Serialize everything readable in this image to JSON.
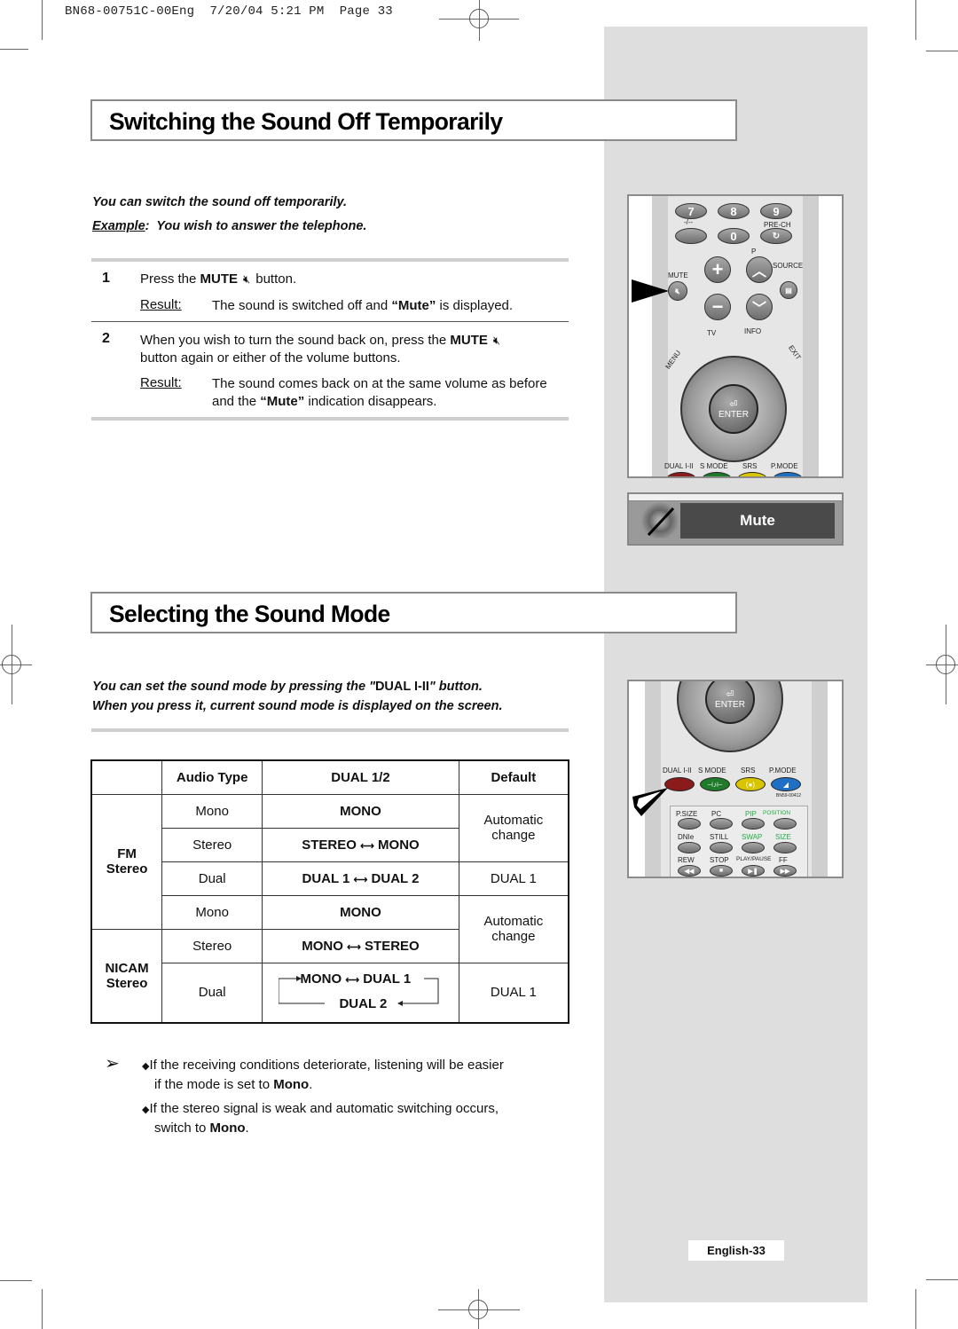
{
  "print_header": {
    "doc_id": "BN68-00751C-00Eng",
    "date": "7/20/04",
    "time": "5:21 PM",
    "page": "Page 33"
  },
  "section1": {
    "title": "Switching the Sound Off Temporarily",
    "intro": "You can switch the sound off temporarily.",
    "example_label": "Example",
    "example_text": "You wish to answer the telephone.",
    "steps": [
      {
        "number": "1",
        "text_before": "Press the ",
        "button_name": "MUTE",
        "text_after": "button.",
        "result_label": "Result:",
        "result_before": "The sound is switched off and ",
        "result_bold": "“Mute”",
        "result_after": " is displayed."
      },
      {
        "number": "2",
        "text_before": "When you wish to turn the sound back on, press the ",
        "button_name": "MUTE",
        "text_line2": "button again or either of the volume buttons.",
        "result_label": "Result:",
        "result_line1": "The sound comes back on at the same volume as before",
        "result_before": "and the ",
        "result_bold": "“Mute”",
        "result_after": " indication disappears."
      }
    ],
    "remote": {
      "number_buttons": [
        "7",
        "8",
        "9",
        "0"
      ],
      "labels": {
        "dash": "-/--",
        "prech": "PRE-CH",
        "vol_indicator": "◢",
        "p": "P",
        "mute": "MUTE",
        "source": "SOURCE",
        "tv": "TV",
        "info": "INFO",
        "menu": "MENU",
        "exit": "EXIT",
        "enter": "ENTER",
        "dual": "DUAL I-II",
        "smode": "S MODE",
        "srs": "SRS",
        "pmode": "P.MODE"
      }
    },
    "osd": {
      "label": "Mute"
    }
  },
  "section2": {
    "title": "Selecting the Sound Mode",
    "intro_line1_before": "You can set the sound mode by pressing the \"",
    "intro_button": "DUAL I-II",
    "intro_line1_after": "\" button.",
    "intro_line2": "When you press it, current sound mode is displayed on the screen.",
    "table": {
      "headers": [
        "",
        "Audio Type",
        "DUAL 1/2",
        "Default"
      ],
      "groups": [
        {
          "name_line1": "FM",
          "name_line2": "Stereo"
        },
        {
          "name_line1": "NICAM",
          "name_line2": "Stereo"
        }
      ],
      "rows": [
        {
          "audio": "Mono",
          "dual": "MONO",
          "default": "Automatic change"
        },
        {
          "audio": "Stereo",
          "dual_a": "STEREO",
          "dual_b": "MONO",
          "default": ""
        },
        {
          "audio": "Dual",
          "dual_a": "DUAL 1",
          "dual_b": "DUAL 2",
          "default": "DUAL 1"
        },
        {
          "audio": "Mono",
          "dual": "MONO",
          "default": "Automatic change"
        },
        {
          "audio": "Stereo",
          "dual_a": "MONO",
          "dual_b": "STEREO",
          "default": ""
        },
        {
          "audio": "Dual",
          "dual_a": "MONO",
          "dual_b": "DUAL 1",
          "dual_c": "DUAL 2",
          "default": "DUAL 1"
        }
      ]
    },
    "notes": [
      {
        "before": "If the receiving conditions deteriorate, listening will be easier",
        "line2_before": "if the mode is set to ",
        "bold": "Mono",
        "after": "."
      },
      {
        "before": "If the stereo signal is weak and automatic switching occurs,",
        "line2_before": "switch to ",
        "bold": "Mono",
        "after": "."
      }
    ],
    "remote": {
      "labels": {
        "enter": "ENTER",
        "dual": "DUAL I-II",
        "smode": "S MODE",
        "srs": "SRS",
        "pmode": "P.MODE",
        "model": "BN59-00412",
        "psize": "P.SIZE",
        "pc": "PC",
        "pip": "PIP",
        "position": "POSITION",
        "dnie": "DNIe",
        "still": "STILL",
        "swap": "SWAP",
        "size": "SIZE",
        "rew": "REW",
        "stop": "STOP",
        "playpause": "PLAY/PAUSE",
        "ff": "FF"
      }
    }
  },
  "footer": {
    "page_label": "English-33"
  },
  "colors": {
    "side_column": "#dedede",
    "dual_button": "#8b1a1a",
    "smode_button": "#1f7a2a",
    "srs_button": "#d9c400",
    "pmode_button": "#1f6fc4",
    "pip_label": "#22aa44"
  }
}
